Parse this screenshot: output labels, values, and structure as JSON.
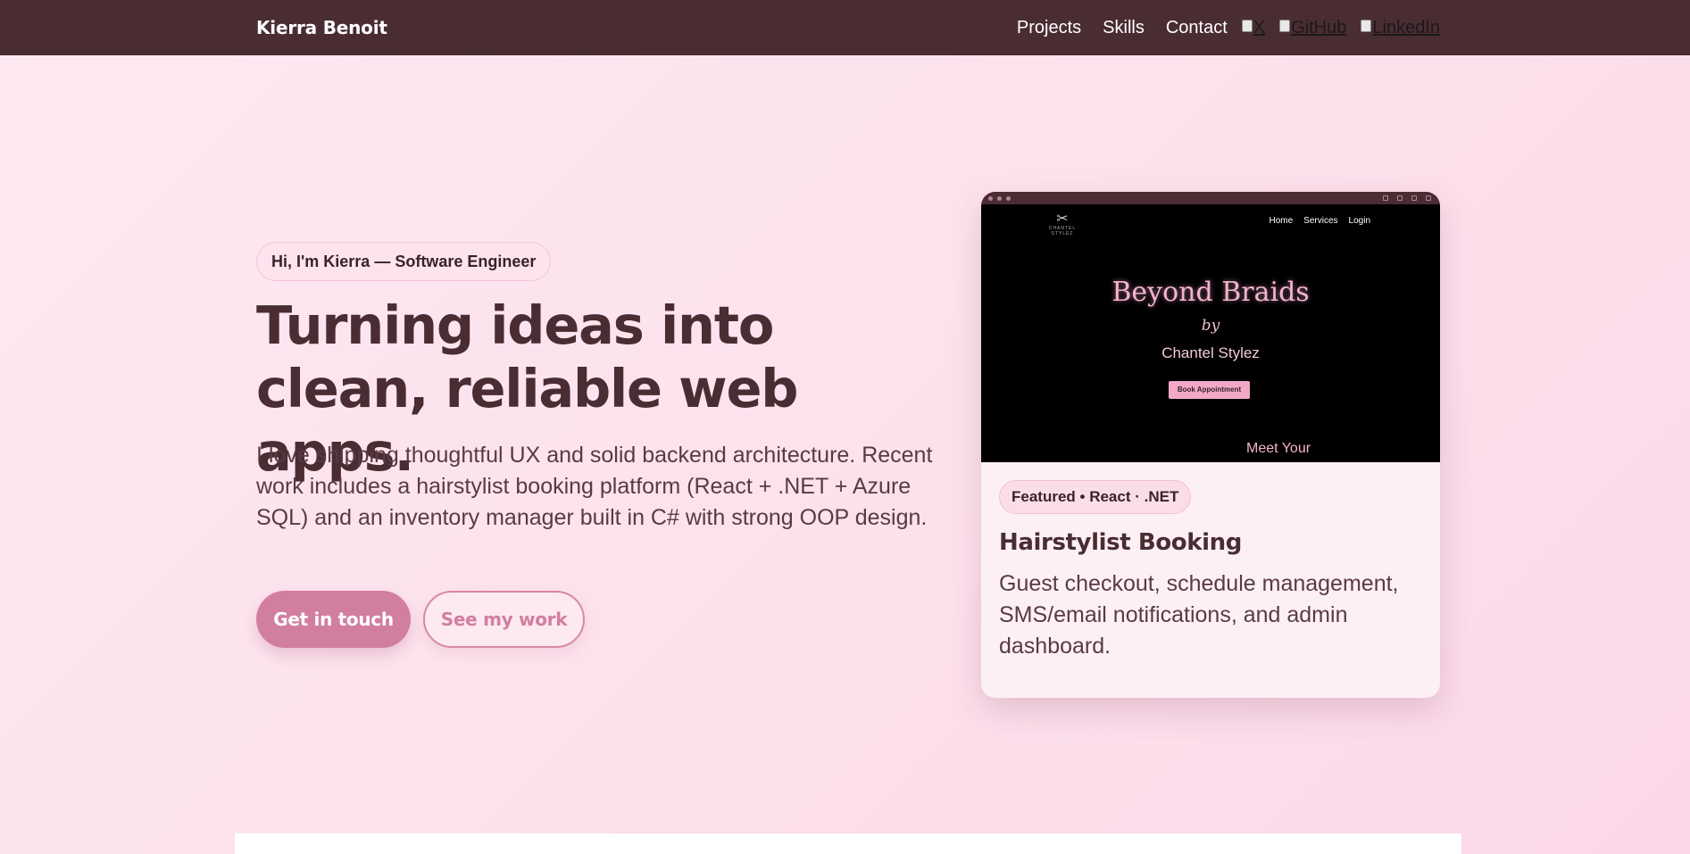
{
  "nav": {
    "brand": "Kierra Benoit",
    "links": [
      "Projects",
      "Skills",
      "Contact"
    ],
    "social": [
      {
        "label": "X",
        "icon": "x-logo-icon"
      },
      {
        "label": "GitHub",
        "icon": "github-logo-icon"
      },
      {
        "label": "LinkedIn",
        "icon": "linkedin-logo-icon"
      }
    ]
  },
  "hero": {
    "intro_pill": "Hi, I'm Kierra — Software Engineer",
    "headline": "Turning ideas into clean, reliable web apps.",
    "lede": "I love shipping thoughtful UX and solid backend architecture. Recent work includes a hairstylist booking platform (React + .NET + Azure SQL) and an inventory manager built in C# with strong OOP design.",
    "cta_primary": "Get in touch",
    "cta_secondary": "See my work"
  },
  "featured": {
    "badge": "Featured • React · .NET",
    "title": "Hairstylist Booking",
    "description": "Guest checkout, schedule management, SMS/email notifications, and admin dashboard.",
    "screenshot": {
      "nav_links": [
        "Home",
        "Services",
        "Login"
      ],
      "logo_text": "CHANTEL STYLEZ",
      "title": "Beyond Braids",
      "by": "by",
      "subtitle": "Chantel Stylez",
      "button": "Book Appointment",
      "footer_text": "Meet Your"
    }
  },
  "colors": {
    "nav_bg": "#4a2c33",
    "accent": "#d27ea0",
    "text": "#4a2c33",
    "page_bg": "#fce1ec"
  }
}
